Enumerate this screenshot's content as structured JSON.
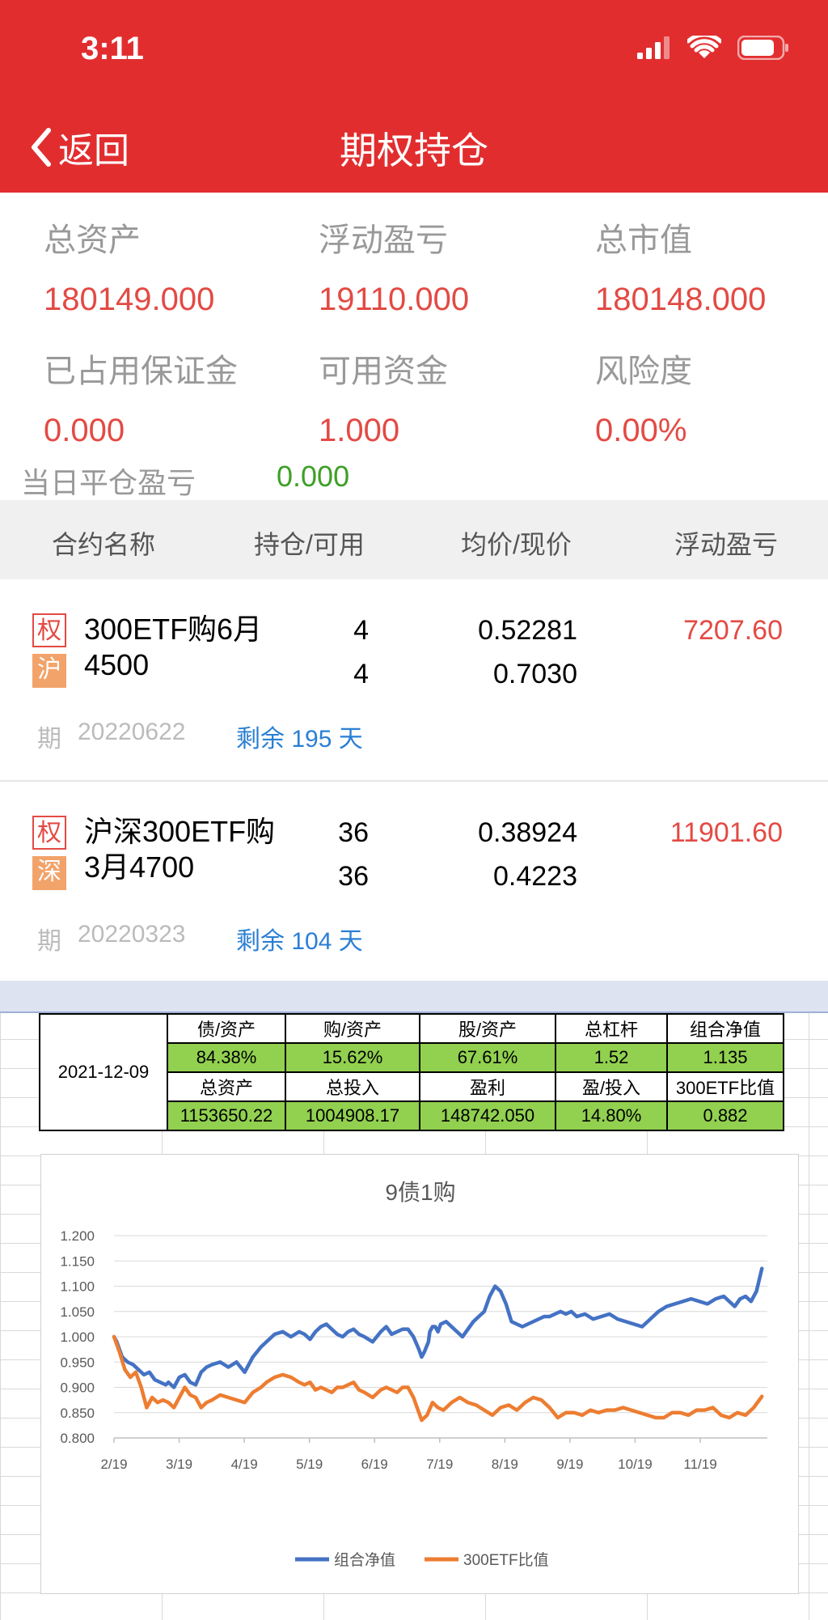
{
  "status": {
    "time": "3:11"
  },
  "nav": {
    "back_label": "返回",
    "title": "期权持仓"
  },
  "summary": {
    "total_assets": {
      "label": "总资产",
      "value": "180149.000"
    },
    "floating_pnl": {
      "label": "浮动盈亏",
      "value": "19110.000"
    },
    "market_value": {
      "label": "总市值",
      "value": "180148.000"
    },
    "margin_used": {
      "label": "已占用保证金",
      "value": "0.000"
    },
    "available": {
      "label": "可用资金",
      "value": "1.000"
    },
    "risk": {
      "label": "风险度",
      "value": "0.00%"
    },
    "today_close_pnl": {
      "label": "当日平仓盈亏",
      "value": "0.000"
    }
  },
  "table_header": {
    "name": "合约名称",
    "position": "持仓/可用",
    "price": "均价/现价",
    "pnl": "浮动盈亏"
  },
  "positions": [
    {
      "tag": "权",
      "exchange": "沪",
      "name": "300ETF购6月4500",
      "hold": "4",
      "avail": "4",
      "avg": "0.52281",
      "cur": "0.7030",
      "pnl": "7207.60",
      "qi": "期",
      "date": "20220622",
      "remain": "剩余 195 天"
    },
    {
      "tag": "权",
      "exchange": "深",
      "name": "沪深300ETF购3月4700",
      "hold": "36",
      "avail": "36",
      "avg": "0.38924",
      "cur": "0.4223",
      "pnl": "11901.60",
      "qi": "期",
      "date": "20220323",
      "remain": "剩余 104 天"
    }
  ],
  "sheet_table": {
    "date": "2021-12-09",
    "row1_labels": [
      "债/资产",
      "购/资产",
      "股/资产",
      "总杠杆",
      "组合净值"
    ],
    "row1_values": [
      "84.38%",
      "15.62%",
      "67.61%",
      "1.52",
      "1.135"
    ],
    "row2_labels": [
      "总资产",
      "总投入",
      "盈利",
      "盈/投入",
      "300ETF比值"
    ],
    "row2_values": [
      "1153650.22",
      "1004908.17",
      "148742.050",
      "14.80%",
      "0.882"
    ]
  },
  "chart_data": {
    "type": "line",
    "title": "9债1购",
    "x_ticks": [
      "2/19",
      "3/19",
      "4/19",
      "5/19",
      "6/19",
      "7/19",
      "8/19",
      "9/19",
      "10/19",
      "11/19"
    ],
    "y_ticks": [
      "1.200",
      "1.150",
      "1.100",
      "1.050",
      "1.000",
      "0.950",
      "0.900",
      "0.850",
      "0.800"
    ],
    "ylim": [
      0.8,
      1.2
    ],
    "x_unit": "months since 2/19",
    "grid": true,
    "legend_position": "bottom",
    "series": [
      {
        "name": "组合净值",
        "color": "#4472c4",
        "x": [
          0,
          0.1,
          0.3,
          0.5,
          0.7,
          0.9,
          1.1,
          1.3,
          1.5,
          1.7,
          1.9,
          2.0,
          2.2,
          2.4,
          2.6,
          2.8,
          3.0,
          3.2,
          3.4,
          3.6,
          3.9,
          4.2,
          4.5,
          4.8,
          5.1,
          5.4,
          5.6,
          5.9,
          6.2,
          6.5,
          6.8,
          7.0,
          7.2,
          7.4,
          7.6,
          7.8,
          8.0,
          8.2,
          8.4,
          8.6,
          8.8,
          9.0,
          9.2,
          9.5,
          9.8,
          10.0,
          10.2,
          10.4,
          10.6,
          10.8,
          11.0,
          11.2,
          11.3,
          11.4,
          11.55,
          11.6,
          11.7,
          11.8,
          11.9,
          12.0,
          12.2,
          12.4,
          12.6,
          12.8,
          13.0,
          13.2,
          13.4,
          13.6,
          13.8,
          14.0,
          14.2,
          14.4,
          14.6,
          14.8,
          15.0,
          15.2,
          15.4,
          15.6,
          15.8,
          16.0,
          16.2,
          16.4,
          16.6,
          16.8,
          17.0,
          17.3,
          17.6,
          17.9,
          18.2,
          18.5,
          18.8,
          19.1,
          19.4,
          19.7,
          20.0,
          20.3,
          20.6,
          20.9,
          21.2,
          21.5,
          21.8,
          22.1,
          22.4,
          22.6,
          22.8,
          23.0,
          23.2,
          23.4,
          23.6,
          23.8
        ],
        "y": [
          1.0,
          0.99,
          0.96,
          0.95,
          0.945,
          0.935,
          0.925,
          0.93,
          0.915,
          0.91,
          0.905,
          0.91,
          0.9,
          0.92,
          0.925,
          0.91,
          0.905,
          0.93,
          0.94,
          0.945,
          0.95,
          0.94,
          0.95,
          0.93,
          0.96,
          0.98,
          0.99,
          1.005,
          1.01,
          1.0,
          1.01,
          1.005,
          0.995,
          1.01,
          1.02,
          1.025,
          1.015,
          1.005,
          1.0,
          1.01,
          1.015,
          1.005,
          1.0,
          0.99,
          1.01,
          1.02,
          1.005,
          1.01,
          1.015,
          1.015,
          1.0,
          0.975,
          0.96,
          0.97,
          0.99,
          1.01,
          1.02,
          1.02,
          1.01,
          1.025,
          1.03,
          1.02,
          1.01,
          1.0,
          1.015,
          1.03,
          1.04,
          1.05,
          1.08,
          1.1,
          1.09,
          1.065,
          1.03,
          1.025,
          1.02,
          1.025,
          1.03,
          1.035,
          1.04,
          1.04,
          1.045,
          1.05,
          1.045,
          1.05,
          1.04,
          1.045,
          1.035,
          1.04,
          1.045,
          1.035,
          1.03,
          1.025,
          1.02,
          1.035,
          1.05,
          1.06,
          1.065,
          1.07,
          1.075,
          1.07,
          1.065,
          1.075,
          1.08,
          1.07,
          1.06,
          1.075,
          1.08,
          1.07,
          1.09,
          1.135
        ]
      },
      {
        "name": "300ETF比值",
        "color": "#ed7d31",
        "x": [
          0,
          0.2,
          0.4,
          0.6,
          0.8,
          1.0,
          1.2,
          1.4,
          1.6,
          1.8,
          2.0,
          2.2,
          2.4,
          2.6,
          2.8,
          3.0,
          3.2,
          3.4,
          3.6,
          3.9,
          4.2,
          4.5,
          4.8,
          5.1,
          5.4,
          5.6,
          5.9,
          6.2,
          6.5,
          6.8,
          7.0,
          7.2,
          7.4,
          7.6,
          7.8,
          8.0,
          8.2,
          8.4,
          8.6,
          8.8,
          9.0,
          9.2,
          9.5,
          9.8,
          10.0,
          10.2,
          10.4,
          10.6,
          10.8,
          11.0,
          11.2,
          11.3,
          11.5,
          11.7,
          11.9,
          12.1,
          12.4,
          12.7,
          13.0,
          13.3,
          13.6,
          13.9,
          14.2,
          14.5,
          14.8,
          15.1,
          15.4,
          15.7,
          16.0,
          16.3,
          16.6,
          16.9,
          17.2,
          17.5,
          17.8,
          18.1,
          18.4,
          18.7,
          19.0,
          19.3,
          19.6,
          19.9,
          20.2,
          20.5,
          20.8,
          21.1,
          21.4,
          21.7,
          22.0,
          22.3,
          22.6,
          22.9,
          23.2,
          23.5,
          23.8
        ],
        "y": [
          1.0,
          0.97,
          0.935,
          0.92,
          0.93,
          0.9,
          0.86,
          0.88,
          0.87,
          0.875,
          0.87,
          0.86,
          0.88,
          0.9,
          0.885,
          0.88,
          0.86,
          0.87,
          0.875,
          0.885,
          0.88,
          0.875,
          0.87,
          0.89,
          0.9,
          0.91,
          0.92,
          0.925,
          0.92,
          0.91,
          0.905,
          0.91,
          0.895,
          0.9,
          0.895,
          0.89,
          0.9,
          0.9,
          0.905,
          0.91,
          0.895,
          0.89,
          0.88,
          0.895,
          0.9,
          0.895,
          0.89,
          0.9,
          0.9,
          0.88,
          0.85,
          0.835,
          0.845,
          0.87,
          0.86,
          0.855,
          0.87,
          0.88,
          0.87,
          0.865,
          0.855,
          0.845,
          0.86,
          0.865,
          0.855,
          0.87,
          0.88,
          0.875,
          0.86,
          0.84,
          0.85,
          0.85,
          0.845,
          0.855,
          0.85,
          0.855,
          0.855,
          0.86,
          0.855,
          0.85,
          0.845,
          0.84,
          0.84,
          0.85,
          0.85,
          0.845,
          0.855,
          0.855,
          0.86,
          0.845,
          0.84,
          0.85,
          0.845,
          0.86,
          0.882
        ]
      }
    ]
  }
}
